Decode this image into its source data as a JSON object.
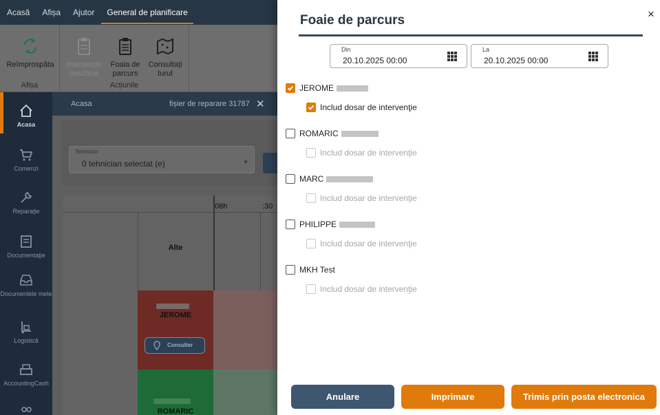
{
  "menubar": {
    "items": [
      "Acasă",
      "Afișa",
      "Ajutor",
      "General de planificare"
    ],
    "active_index": 3
  },
  "ribbon": {
    "refresh": {
      "label": "Reîmprospăta",
      "icon": "refresh-icon"
    },
    "group_afisa": "Afișa",
    "interventions": {
      "label": "Intervenție deschise",
      "icon": "clipboard-icon",
      "disabled": true
    },
    "roadsheet": {
      "label": "Foaia de parcurs",
      "icon": "clipboard-list-icon"
    },
    "tour": {
      "label": "Consultați turul",
      "icon": "map-icon"
    },
    "group_actions": "Acțiunile"
  },
  "sidebar": {
    "items": [
      {
        "label": "Acasa",
        "icon": "home-icon",
        "active": true
      },
      {
        "label": "Comenzi",
        "icon": "cart-icon"
      },
      {
        "label": "Reparaţie",
        "icon": "wrench-icon"
      },
      {
        "label": "Documentaţie",
        "icon": "document-icon"
      },
      {
        "label": "Documentele mele",
        "icon": "inbox-icon"
      },
      {
        "label": "Logistică",
        "icon": "dolly-icon"
      },
      {
        "label": "AccountingCash",
        "icon": "cash-register-icon"
      }
    ]
  },
  "tabs": {
    "home": "Acasa",
    "repair": "fișier de reparare 31787",
    "close": "✕"
  },
  "planning": {
    "tech_label": "Tehnician",
    "tech_value": "0 tehnician selectat (e)",
    "times": [
      "08h",
      ":30"
    ],
    "rows": [
      {
        "label": "Alte"
      },
      {
        "label": "JEROME",
        "button": "Consulter"
      },
      {
        "label": "ROMARIC"
      }
    ]
  },
  "dialog": {
    "title": "Foaie de parcurs",
    "close": "×",
    "date_from": {
      "label": "Din",
      "value": "20.10.2025 00:00"
    },
    "date_to": {
      "label": "La",
      "value": "20.10.2025 00:00"
    },
    "include_label": "Includ dosar de intervenţie",
    "technicians": [
      {
        "name": "JEROME",
        "checked": true,
        "include_checked": true,
        "include_enabled": true
      },
      {
        "name": "ROMARIC",
        "checked": false,
        "include_checked": false,
        "include_enabled": false
      },
      {
        "name": "MARC",
        "checked": false,
        "include_checked": false,
        "include_enabled": false
      },
      {
        "name": "PHILIPPE",
        "checked": false,
        "include_checked": false,
        "include_enabled": false
      },
      {
        "name": "MKH Test",
        "checked": false,
        "include_checked": false,
        "include_enabled": false
      }
    ],
    "buttons": {
      "cancel": "Anulare",
      "print": "Imprimare",
      "email": "Trimis prin posta electronica"
    }
  },
  "colors": {
    "accent": "#e07b0b",
    "navy": "#263645",
    "button_navy": "#3f5670"
  }
}
